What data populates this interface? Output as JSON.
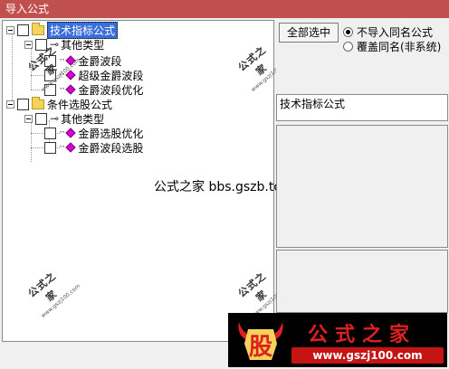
{
  "window": {
    "title": "导入公式"
  },
  "tree": {
    "items": [
      {
        "label": "技术指标公式",
        "level": 0,
        "kind": "folder",
        "selected": true
      },
      {
        "label": "其他类型",
        "level": 1,
        "kind": "key"
      },
      {
        "label": "金爵波段",
        "level": 2,
        "kind": "formula"
      },
      {
        "label": "超级金爵波段",
        "level": 2,
        "kind": "formula"
      },
      {
        "label": "金爵波段优化",
        "level": 2,
        "kind": "formula"
      },
      {
        "label": "条件选股公式",
        "level": 0,
        "kind": "folder"
      },
      {
        "label": "其他类型",
        "level": 1,
        "kind": "key"
      },
      {
        "label": "金爵选股优化",
        "level": 2,
        "kind": "formula"
      },
      {
        "label": "金爵波段选股",
        "level": 2,
        "kind": "formula"
      }
    ]
  },
  "right_panel": {
    "select_all_label": "全部选中",
    "radio_options": [
      {
        "label": "不导入同名公式",
        "checked": true
      },
      {
        "label": "覆盖同名(非系统)",
        "checked": false
      }
    ],
    "category_label": "技术指标公式"
  },
  "watermark": {
    "center_text": "公式之家 bbs.gszb.top",
    "stamp_text": "公式之家",
    "stamp_url": "www.gszj100.com"
  },
  "logo": {
    "badge_char": "股",
    "main_text": "公式之家",
    "url": "www.gszj100.com",
    "colors": {
      "background": "#000000",
      "brand_red": "#e02020",
      "url_band": "#c41414"
    }
  },
  "colors": {
    "titlebar": "#c0504e",
    "selection": "#3a6fd8",
    "formula_icon": "#d400d4"
  }
}
